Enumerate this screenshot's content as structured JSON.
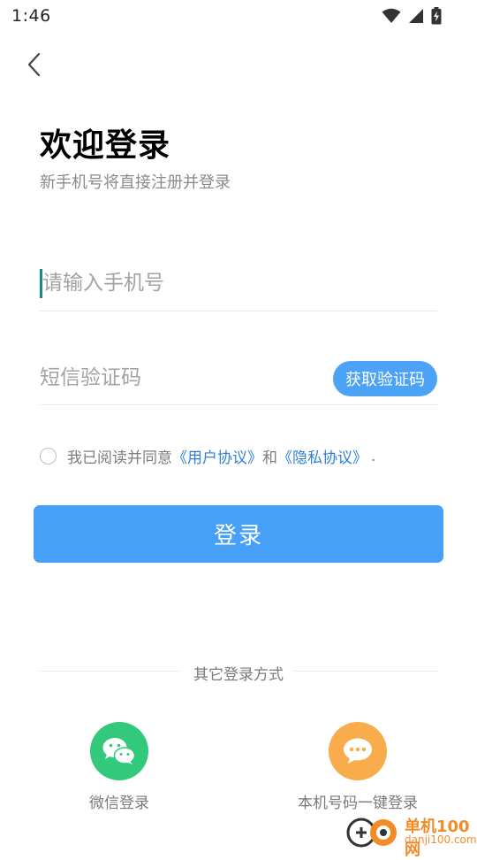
{
  "status_bar": {
    "time": "1:46",
    "icons": [
      "wifi-icon",
      "cellular-signal-icon",
      "battery-charging-icon"
    ]
  },
  "header": {
    "back_icon": "chevron-left-icon",
    "title": "欢迎登录",
    "subtitle": "新手机号将直接注册并登录"
  },
  "form": {
    "phone_placeholder": "请输入手机号",
    "phone_value": "",
    "sms_placeholder": "短信验证码",
    "sms_value": "",
    "get_code_label": "获取验证码"
  },
  "agreement": {
    "checked": false,
    "prefix": "我已阅读并同意",
    "user_agreement": "《用户协议》",
    "conjunction": "和",
    "privacy_policy": "《隐私协议》",
    "suffix": "."
  },
  "login_button_label": "登录",
  "other_methods": {
    "label": "其它登录方式",
    "wechat_label": "微信登录",
    "wechat_icon": "wechat-icon",
    "one_click_label": "本机号码一键登录",
    "one_click_icon": "chat-bubble-icon"
  },
  "watermark": {
    "main": "单机100网",
    "sub": "danji100.com"
  },
  "colors": {
    "primary": "#47a0f7",
    "link": "#2f7fd8",
    "wechat": "#33c97c",
    "one_click": "#f8ac4b",
    "cursor": "#1a8a80"
  }
}
